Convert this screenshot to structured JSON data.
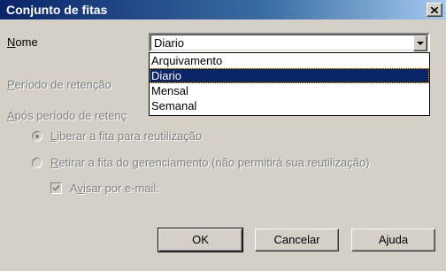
{
  "window": {
    "title": "Conjunto de fitas",
    "close_label": "×"
  },
  "form": {
    "nome_label": "Nome",
    "nome_value": "Diario",
    "periodo_label": "Período de retenção",
    "apos_label": "Após período de retenç",
    "radio_liberar": "Liberar a fita para reutilização",
    "radio_retirar": "Retirar a fita do gerenciamento (não permitirá sua reutilização)",
    "checkbox_avisar": "Avisar por e-mail:"
  },
  "dropdown": {
    "options": [
      "Arquivamento",
      "Diario",
      "Mensal",
      "Semanal"
    ],
    "selected": "Diario"
  },
  "buttons": {
    "ok": "OK",
    "cancel": "Cancelar",
    "help": "Ajuda"
  },
  "colors": {
    "title_bar": "#0a246a",
    "face": "#d4d0c8",
    "selection": "#0a246a",
    "disabled_text": "#808080"
  }
}
